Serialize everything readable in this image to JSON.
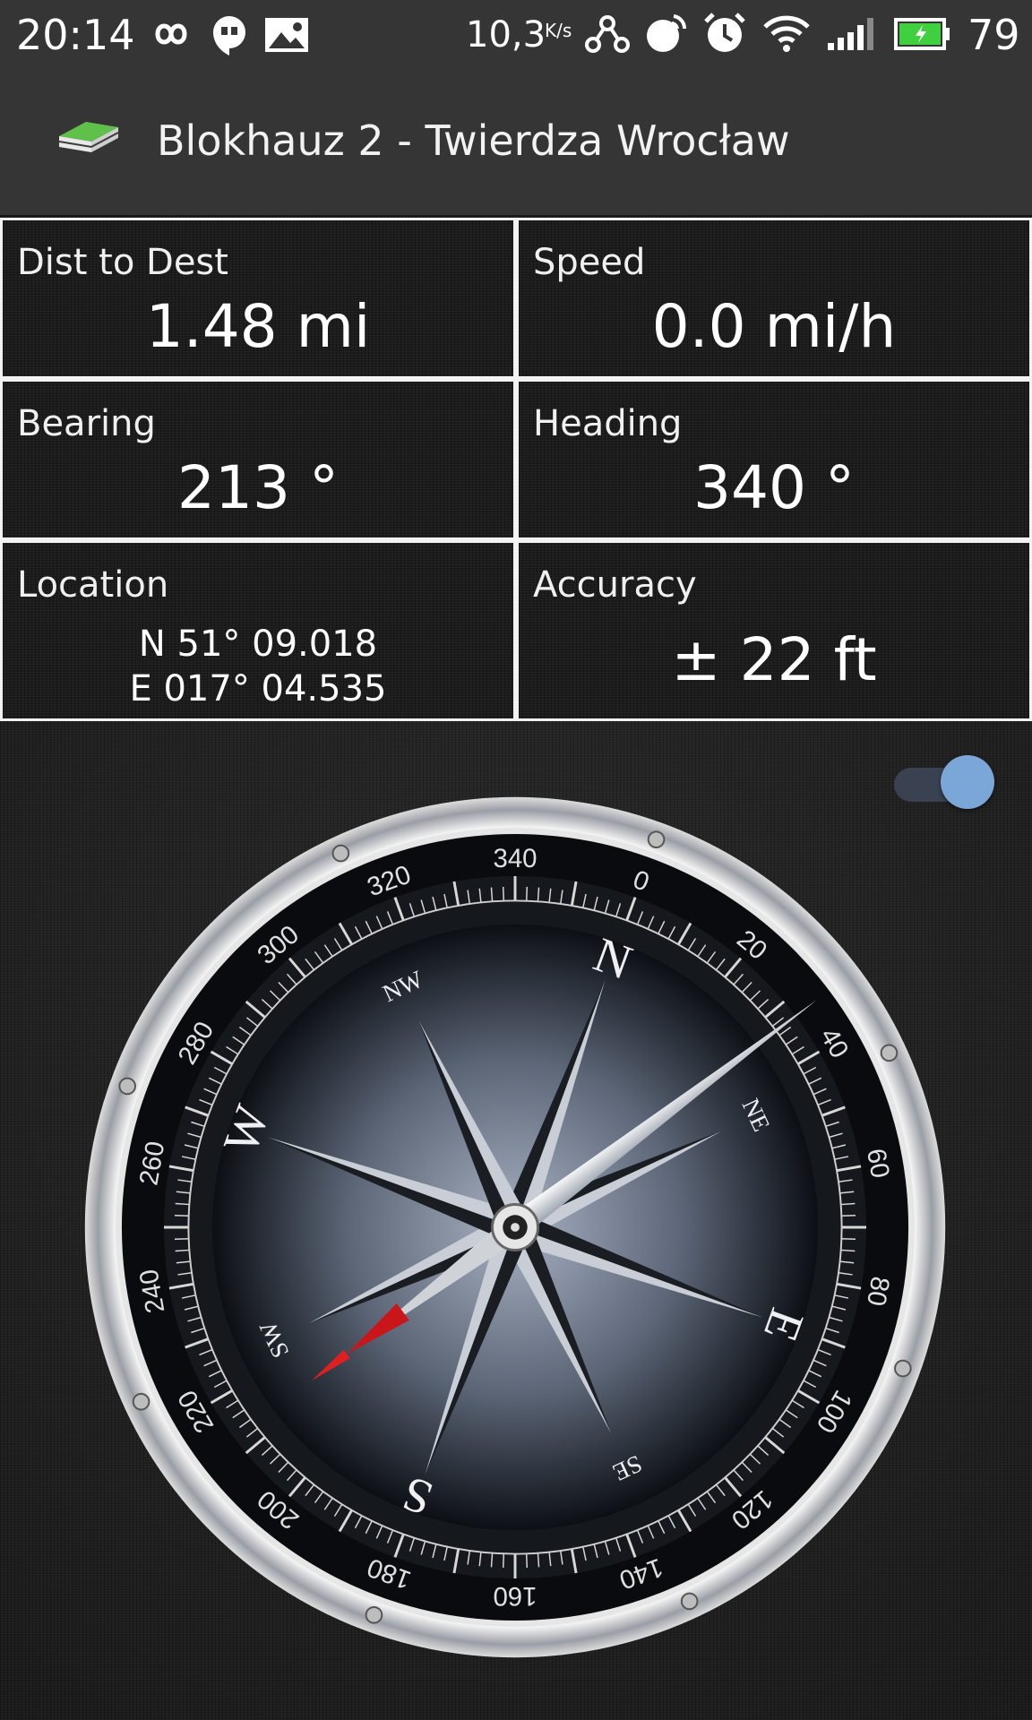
{
  "status_bar": {
    "time": "20:14",
    "net_speed": "10,3",
    "net_unit": "K/s",
    "battery_level": "79",
    "icons": [
      "infinity-icon",
      "hangouts-icon",
      "gallery-icon",
      "network-icon",
      "sync-icon",
      "alarm-icon",
      "wifi-icon",
      "signal-icon",
      "battery-icon"
    ]
  },
  "app_bar": {
    "title": "Blokhauz 2 - Twierdza Wrocław",
    "icon": "geocache-box-icon"
  },
  "stats": {
    "dist": {
      "label": "Dist to Dest",
      "value": "1.48 mi"
    },
    "speed": {
      "label": "Speed",
      "value": "0.0 mi/h"
    },
    "bearing": {
      "label": "Bearing",
      "value": "213 °"
    },
    "heading": {
      "label": "Heading",
      "value": "340 °"
    },
    "location": {
      "label": "Location",
      "lat": "N 51° 09.018",
      "lon": "E 017° 04.535"
    },
    "accuracy": {
      "label": "Accuracy",
      "value": "± 22 ft"
    }
  },
  "compass": {
    "heading_deg": 340,
    "bearing_deg": 213,
    "degree_labels": [
      "0",
      "20",
      "40",
      "60",
      "80",
      "100",
      "120",
      "140",
      "160",
      "180",
      "200",
      "220",
      "240",
      "260",
      "280",
      "300",
      "320",
      "340"
    ],
    "cardinals": {
      "N": "N",
      "NE": "NE",
      "E": "E",
      "SE": "SE",
      "S": "S",
      "SW": "SW",
      "W": "W",
      "NW": "NW"
    }
  },
  "toggle": {
    "on": true
  },
  "colors": {
    "bar_bg": "#353535",
    "accent": "#7aa6d8",
    "needle_red": "#c8161b"
  }
}
